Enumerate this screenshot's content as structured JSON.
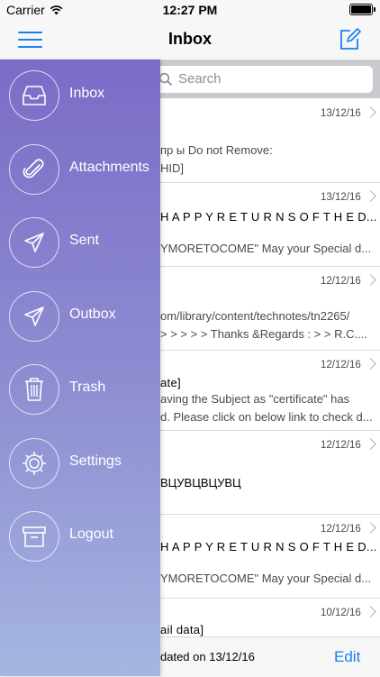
{
  "status_bar": {
    "carrier": "Carrier",
    "time": "12:27 PM"
  },
  "nav": {
    "title": "Inbox",
    "menu_icon": "hamburger-icon",
    "compose_icon": "compose-icon"
  },
  "search": {
    "placeholder": "Search"
  },
  "mails": [
    {
      "date": "13/12/16",
      "subject": "",
      "preview1": "пр ы Do not Remove:",
      "preview2": "HID]"
    },
    {
      "date": "13/12/16",
      "subject": "H A P P Y R E T U R N S O F T H E D...",
      "preview1": "",
      "preview2": "YMORETOCOME\" May your Special d..."
    },
    {
      "date": "12/12/16",
      "subject": "",
      "preview1": "om/library/content/technotes/tn2265/",
      "preview2": "> > > > > Thanks &Regards : > > R.C...."
    },
    {
      "date": "12/12/16",
      "subject": "ate]",
      "preview1": "aving the Subject as \"certificate\" has",
      "preview2": "d. Please click on below link to check d..."
    },
    {
      "date": "12/12/16",
      "subject": "",
      "preview1": "ВЦУВЦВЦУВЦ",
      "preview2": ""
    },
    {
      "date": "12/12/16",
      "subject": "H A P P Y R E T U R N S O F T H E D...",
      "preview1": "",
      "preview2": "YMORETOCOME\" May your Special d..."
    },
    {
      "date": "10/12/16",
      "subject": "ail data]",
      "preview1": "",
      "preview2": ""
    }
  ],
  "bottom_bar": {
    "updated": "dated on 13/12/16",
    "edit_label": "Edit"
  },
  "drawer": {
    "items": [
      {
        "label": "Inbox",
        "icon": "inbox-icon"
      },
      {
        "label": "Attachments",
        "icon": "paperclip-icon"
      },
      {
        "label": "Sent",
        "icon": "paper-plane-icon"
      },
      {
        "label": "Outbox",
        "icon": "paper-plane-icon"
      },
      {
        "label": "Trash",
        "icon": "trash-icon"
      },
      {
        "label": "Settings",
        "icon": "gear-icon"
      },
      {
        "label": "Logout",
        "icon": "archive-box-icon"
      }
    ]
  },
  "colors": {
    "accent": "#1a7ef2",
    "drawer_top": "#7a6cc7",
    "drawer_bottom": "#a5b6e1"
  }
}
